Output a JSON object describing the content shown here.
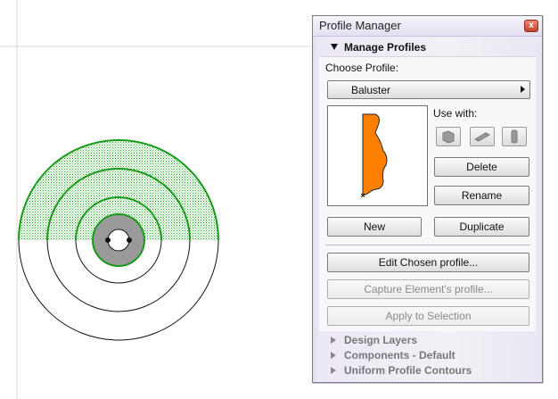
{
  "palette": {
    "title": "Profile Manager",
    "close_glyph": "x",
    "manage_section": "Manage Profiles",
    "choose_label": "Choose Profile:",
    "selected_profile": "Baluster",
    "use_with_label": "Use with:",
    "use_with_icons": [
      "wall-icon",
      "beam-icon",
      "column-icon"
    ],
    "buttons": {
      "delete": "Delete",
      "rename": "Rename",
      "new": "New",
      "duplicate": "Duplicate",
      "edit": "Edit Chosen profile...",
      "capture": "Capture Element's profile...",
      "apply": "Apply to Selection"
    },
    "collapsed_sections": [
      "Design Layers",
      "Components - Default",
      "Uniform Profile Contours"
    ]
  },
  "colors": {
    "profile_fill": "#ff7f00",
    "hatch_green": "#22aa22",
    "ring_green": "#1a9a1a",
    "core_gray": "#9a9a9a"
  }
}
